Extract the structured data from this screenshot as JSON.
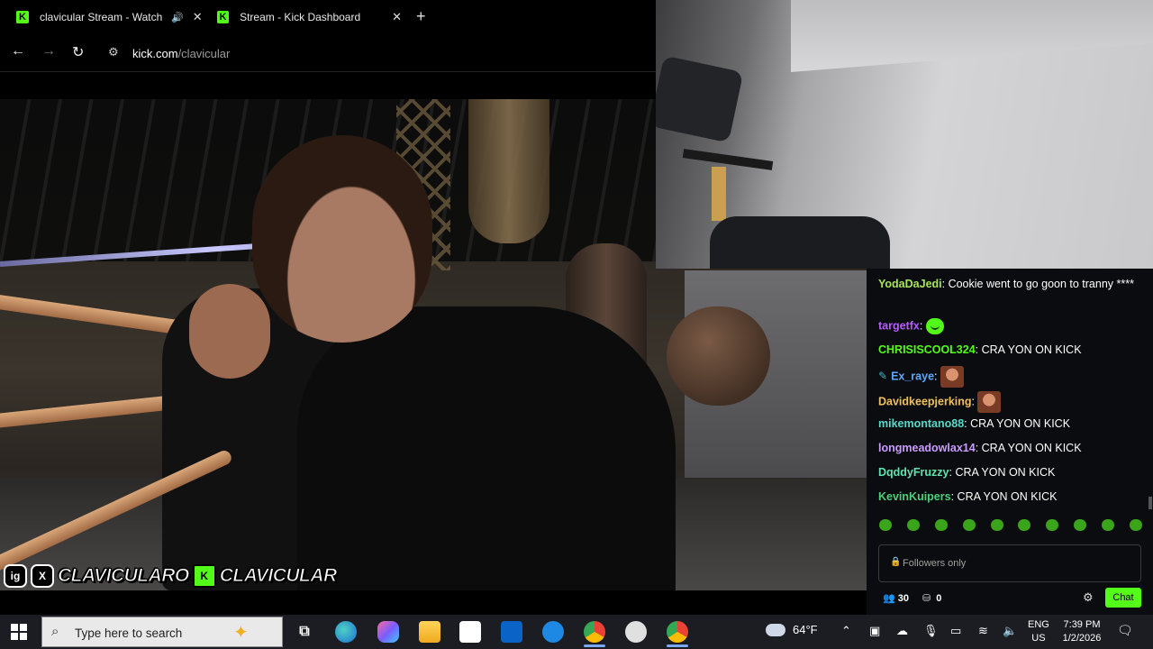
{
  "browser": {
    "tabs": [
      {
        "title": "clavicular Stream - Watch Li",
        "close": "✕",
        "favicon": "K",
        "audio_icon": "🔊"
      },
      {
        "title": "Stream - Kick Dashboard",
        "close": "✕",
        "favicon": "K"
      }
    ],
    "new_tab": "+",
    "nav": {
      "back": "←",
      "forward": "→",
      "reload": "↻",
      "site_info": "⚙"
    },
    "url": {
      "domain": "kick.com",
      "path": "/clavicular"
    }
  },
  "video": {
    "watermark": {
      "instagram_icon": "ig",
      "x_icon": "X",
      "handle_text": "CLAVICULARO",
      "kick_icon": "K",
      "kick_text": "CLAVICULAR"
    }
  },
  "chat": {
    "messages": [
      {
        "user": "YodaDaJedi",
        "color": "#a8e45a",
        "text": "Cookie went to go goon to tranny ****"
      },
      {
        "user": "targetfx",
        "color": "#b45cff",
        "text": "",
        "emote": "green-blob"
      },
      {
        "user": "CHRISISCOOL324",
        "color": "#53fc18",
        "text": "CRA YON ON KICK"
      },
      {
        "user": "Ex_raye",
        "color": "#5aa8ff",
        "text": "",
        "emote": "face",
        "badge": "✎"
      },
      {
        "user": "Davidkeepjerking",
        "color": "#f0c060",
        "text": "",
        "emote": "face"
      },
      {
        "user": "mikemontano88",
        "color": "#58d8c8",
        "text": "CRA YON ON KICK"
      },
      {
        "user": "longmeadowlax14",
        "color": "#c99cff",
        "text": "CRA YON ON KICK"
      },
      {
        "user": "DqddyFruzzy",
        "color": "#5fe3b0",
        "text": "CRA YON ON KICK"
      },
      {
        "user": "KevinKuipers",
        "color": "#4ad07a",
        "text": "CRA YON ON KICK"
      }
    ],
    "separator": ": ",
    "input_placeholder": "Followers only",
    "lock_icon": "🔒",
    "viewers": "30",
    "viewers_icon": "👥",
    "subs": "0",
    "subs_icon": "⛁",
    "settings_icon": "⚙",
    "chat_button": "Chat",
    "accent": "#53fc18"
  },
  "taskbar": {
    "search_placeholder": "Type here to search",
    "search_icon": "⌕",
    "spark_icon": "✦",
    "taskview_icon": "⧉",
    "weather": "64°F",
    "tray_chevron": "⌃",
    "lang_line1": "ENG",
    "lang_line2": "US",
    "time": "7:39 PM",
    "date": "1/2/2026",
    "notification_icon": "🗨"
  }
}
